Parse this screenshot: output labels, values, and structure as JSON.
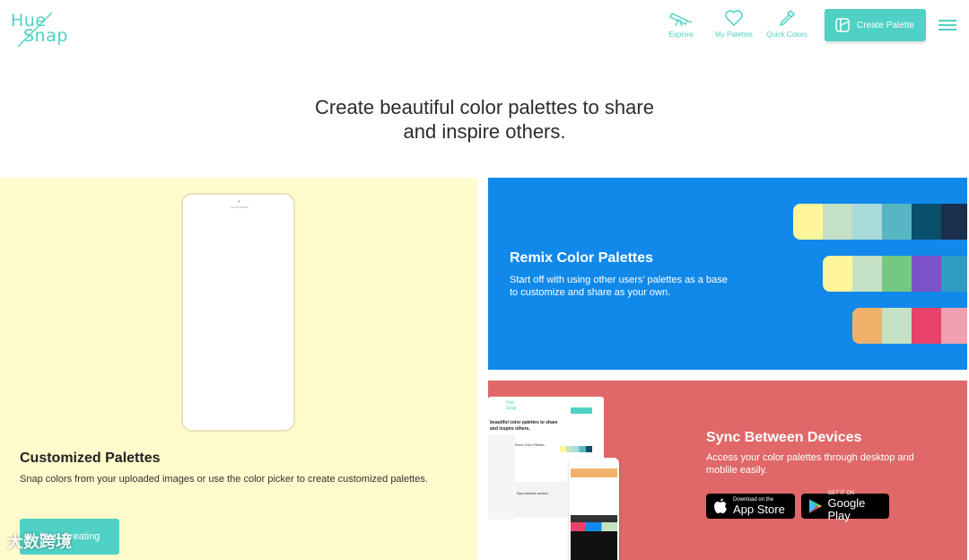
{
  "header": {
    "logo_top": "Hue",
    "logo_bottom": "Snap",
    "nav": [
      {
        "label": "Explore",
        "icon": "telescope-icon"
      },
      {
        "label": "My Palettes",
        "icon": "heart-icon"
      },
      {
        "label": "Quick Colors",
        "icon": "eyedropper-icon"
      }
    ],
    "create_label": "Create Palette"
  },
  "hero": {
    "line1": "Create beautiful color palettes to share",
    "line2": "and inspire others."
  },
  "custom": {
    "title": "Customized Palettes",
    "text": "Snap colors from your uploaded images or use the color picker to create customized palettes.",
    "button": "Start Creating"
  },
  "remix": {
    "title": "Remix Color Palettes",
    "text_line1": "Start off with using other users' palettes as a base",
    "text_line2": "to customize and share as your own.",
    "rows": [
      [
        "#fff59d",
        "#c5e1c5",
        "#a8dadc",
        "#57b6c2",
        "#0a4f6b",
        "#1a2f4b"
      ],
      [
        "#fff59d",
        "#c5e1c5",
        "#74c982",
        "#7b52c7",
        "#2f9bc1"
      ],
      [
        "#f0b26b",
        "#c5e1c5",
        "#e8416b",
        "#f0a0b0"
      ]
    ]
  },
  "sync": {
    "title": "Sync Between Devices",
    "text_line1": "Access your color palettes through desktop and",
    "text_line2": "moblile easily.",
    "appstore_small": "Download on the",
    "appstore_big": "App Store",
    "play_small": "GET IT ON",
    "play_big": "Google Play",
    "mock": {
      "logo_top": "Hue",
      "logo_bottom": "Snap",
      "hero_line1": "beautiful color palettes to share",
      "hero_line2": "and inspire others.",
      "remix_title": "Remix Color Palettes",
      "sync_title": "Sync between devices"
    }
  },
  "watermark": "大数跨境",
  "colors": {
    "accent": "#4fd1c5",
    "yellow": "#fffbcc",
    "blue": "#1189eb",
    "red": "#e06868"
  }
}
